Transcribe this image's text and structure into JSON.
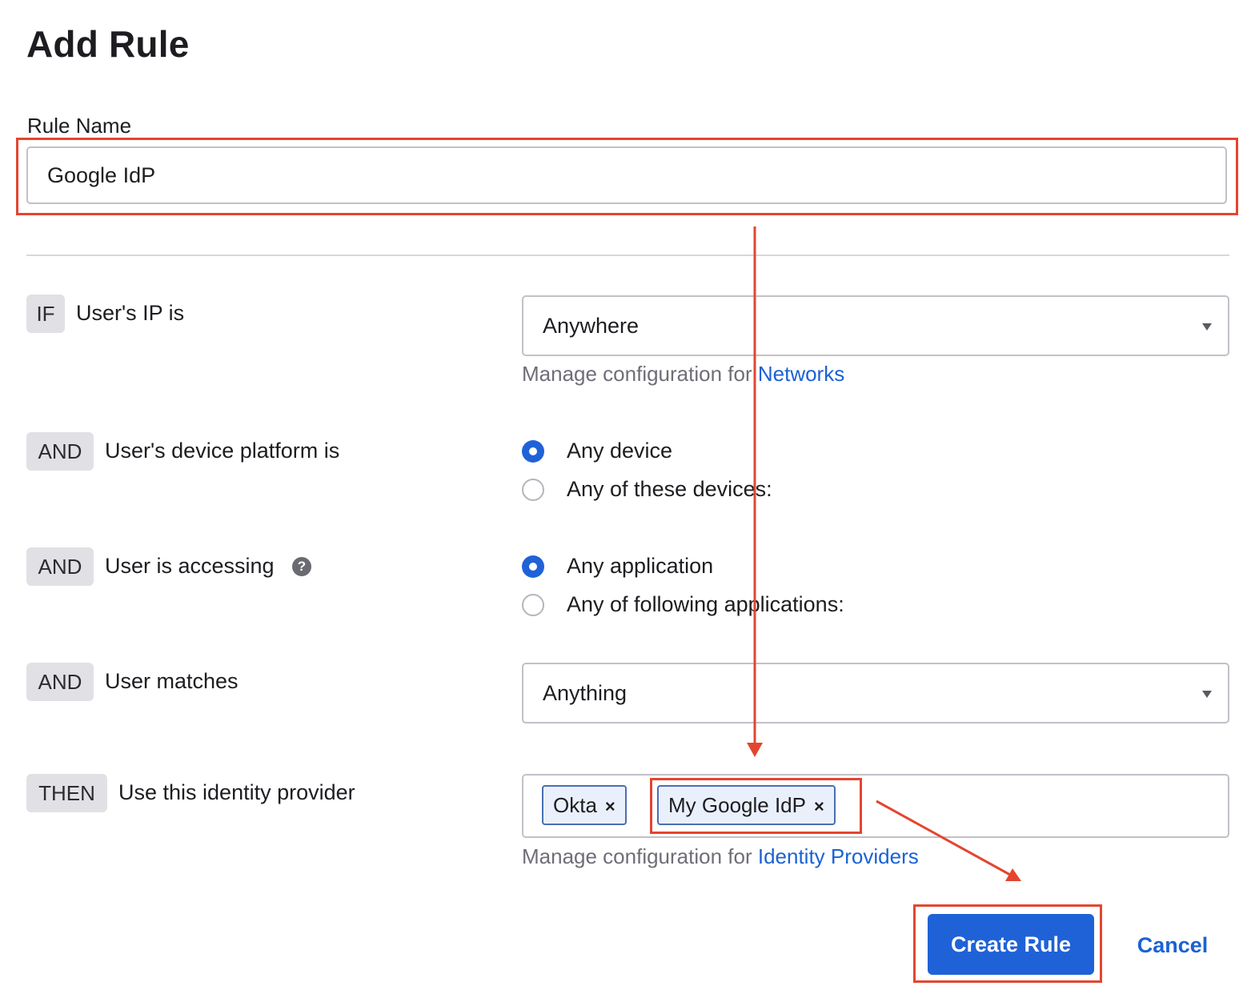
{
  "page": {
    "title": "Add Rule"
  },
  "rule_name": {
    "label": "Rule Name",
    "value": "Google IdP"
  },
  "conditions": [
    {
      "operator": "IF",
      "text": "User's IP is"
    },
    {
      "operator": "AND",
      "text": "User's device platform is"
    },
    {
      "operator": "AND",
      "text": "User is accessing"
    },
    {
      "operator": "AND",
      "text": "User matches"
    },
    {
      "operator": "THEN",
      "text": "Use this identity provider"
    }
  ],
  "ip_select": {
    "value": "Anywhere",
    "help_prefix": "Manage configuration for",
    "help_link": "Networks"
  },
  "device_platform": {
    "options": [
      "Any device",
      "Any of these devices:"
    ],
    "selected": "Any device"
  },
  "accessing": {
    "help_icon": "?",
    "options": [
      "Any application",
      "Any of following applications:"
    ],
    "selected": "Any application"
  },
  "user_matches_select": {
    "value": "Anything"
  },
  "identity_providers": {
    "chips": [
      "Okta",
      "My Google IdP"
    ],
    "remove_glyph": "×",
    "help_prefix": "Manage configuration for",
    "help_link": "Identity Providers"
  },
  "actions": {
    "primary": "Create Rule",
    "secondary": "Cancel"
  },
  "colors": {
    "accent": "#1f62d8",
    "link": "#1a62d4",
    "annotation": "#e4452f",
    "pill_bg": "#e1e1e5"
  },
  "icons": [
    "chevron-down-icon",
    "help-icon",
    "close-icon",
    "annotation-arrow"
  ]
}
